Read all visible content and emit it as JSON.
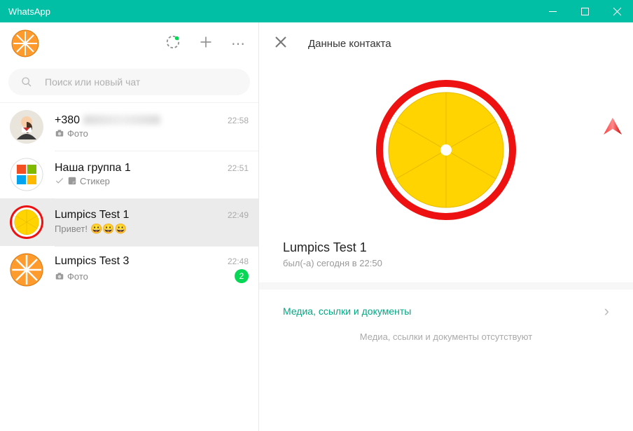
{
  "app_title": "WhatsApp",
  "search": {
    "placeholder": "Поиск или новый чат"
  },
  "chats": [
    {
      "name": "+380",
      "time": "22:58",
      "preview_label": "Фото"
    },
    {
      "name": "Наша группа 1",
      "time": "22:51",
      "preview_label": "Стикер"
    },
    {
      "name": "Lumpics Test 1",
      "time": "22:49",
      "preview_text": "Привет! ",
      "emoji_triplet": "😀😀😀"
    },
    {
      "name": "Lumpics Test 3",
      "time": "22:48",
      "preview_label": "Фото",
      "badge": "2"
    }
  ],
  "contact_panel": {
    "header": "Данные контакта",
    "name": "Lumpics Test 1",
    "status": "был(-а) сегодня в 22:50",
    "media_section_label": "Медиа, ссылки и документы",
    "media_empty_text": "Медиа, ссылки и документы отсутствуют"
  },
  "colors": {
    "accent": "#00bfa5",
    "badge": "#06d755",
    "link": "#00a884",
    "arrow": "#ff1a1a"
  }
}
